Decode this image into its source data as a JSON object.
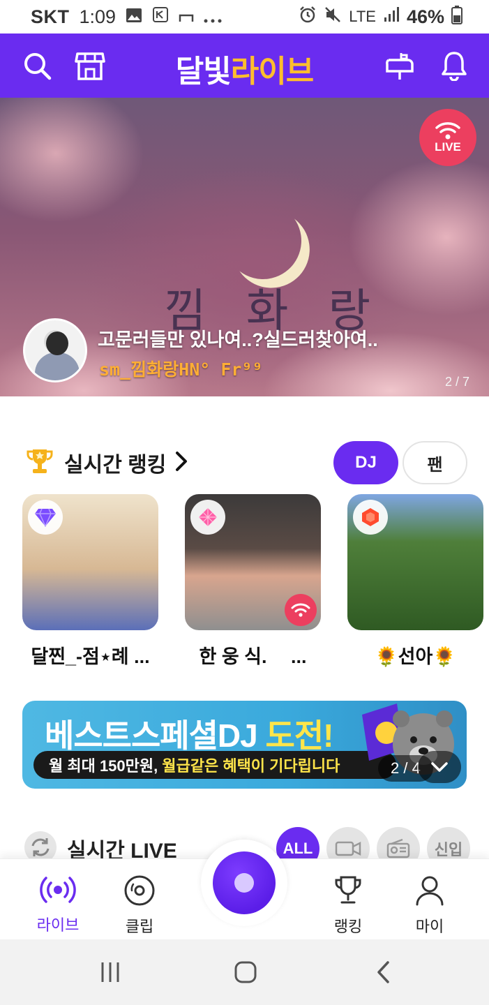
{
  "status_bar": {
    "carrier": "SKT",
    "time": "1:09",
    "network": "LTE",
    "battery": "46%"
  },
  "appbar": {
    "logo_white": "달빛",
    "logo_orange": "라이브"
  },
  "banner": {
    "live_label": "LIVE",
    "art_text": "낌 화 랑",
    "title": "고문러들만 있나여..?실드러찾아여..",
    "dj_name": "sm_낌화랑HN° Fr⁹⁹",
    "page": "2 / 7"
  },
  "ranking": {
    "title": "실시간 랭킹",
    "toggle": {
      "dj": "DJ",
      "fan": "팬"
    },
    "cards": [
      {
        "name": "달찐_-점⋆례 ...",
        "gem_color": "#7b4cff"
      },
      {
        "name": "한 웅 식.　 ...",
        "gem_color": "#ff5fa8"
      },
      {
        "name": "🌻선아🌻",
        "gem_color": "#ff4b2e"
      }
    ]
  },
  "promo": {
    "title_white": "베스트스페셜DJ ",
    "title_yellow": "도전!",
    "subtitle_white": "월 최대 150만원,",
    "subtitle_yellow": "월급같은 혜택이 기다립니다",
    "page": "2 / 4"
  },
  "live_section": {
    "title": "실시간 LIVE",
    "filters": {
      "all": "ALL",
      "newbie": "신입"
    }
  },
  "bottom_nav": {
    "live": "라이브",
    "clip": "클립",
    "ranking": "랭킹",
    "my": "마이"
  },
  "colors": {
    "primary": "#6a2cf0",
    "accent": "#ffbe2e",
    "live_red": "#ec3f5f"
  }
}
